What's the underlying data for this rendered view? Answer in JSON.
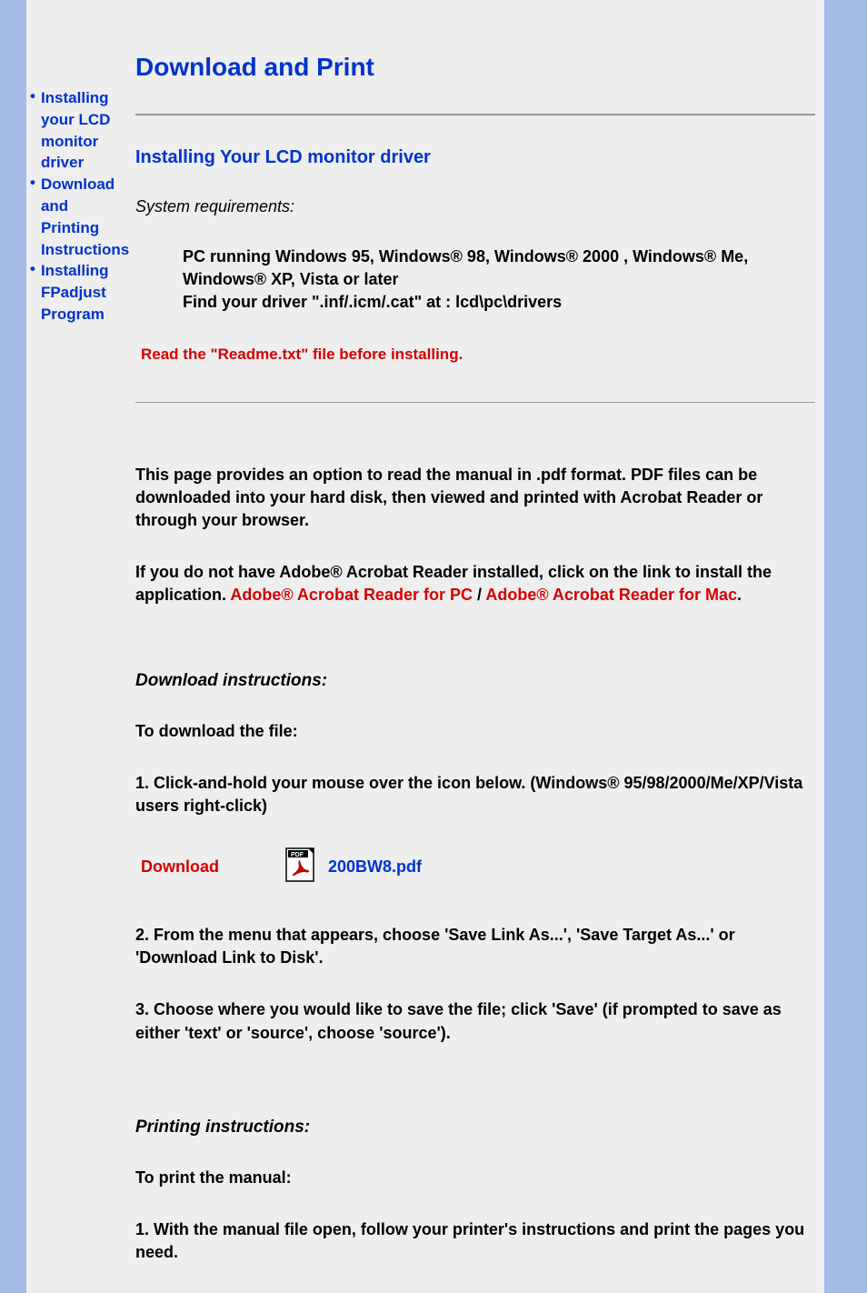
{
  "sidebar": {
    "items": [
      {
        "label": "Installing your LCD monitor driver"
      },
      {
        "label": "Download and Printing Instructions"
      },
      {
        "label": "Installing FPadjust Program"
      }
    ]
  },
  "main": {
    "title": "Download and Print",
    "section1": {
      "heading": "Installing Your LCD monitor driver",
      "sysreq_label": "System requirements:",
      "req1": "PC running Windows 95, Windows® 98, Windows® 2000 , Windows® Me, Windows® XP, Vista or later",
      "req2": "Find your driver \".inf/.icm/.cat\" at : lcd\\pc\\drivers",
      "warning": "Read the \"Readme.txt\" file before installing."
    },
    "section2": {
      "para1": "This page provides an option to read the manual in .pdf format. PDF files can be downloaded into your hard disk, then viewed and printed with Acrobat Reader or through your browser.",
      "para2_prefix": "If you do not have Adobe® Acrobat Reader installed, click on the link to install the application. ",
      "link_pc": "Adobe® Acrobat Reader for PC",
      "sep": " / ",
      "link_mac": "Adobe® Acrobat Reader for Mac",
      "period": "."
    },
    "download": {
      "heading": "Download instructions:",
      "intro": "To download the file:",
      "step1": "1. Click-and-hold your mouse over the icon below. (Windows® 95/98/2000/Me/XP/Vista users right-click)",
      "label": "Download",
      "filename": "200BW8.pdf",
      "step2": "2. From the menu that appears, choose 'Save Link As...', 'Save Target As...' or 'Download Link to Disk'.",
      "step3": "3. Choose where you would like to save the file; click 'Save' (if prompted to save as either 'text' or 'source', choose 'source')."
    },
    "printing": {
      "heading": "Printing instructions:",
      "intro": "To print the manual:",
      "step1": "1. With the manual file open, follow your printer's instructions and print the pages you need."
    }
  }
}
